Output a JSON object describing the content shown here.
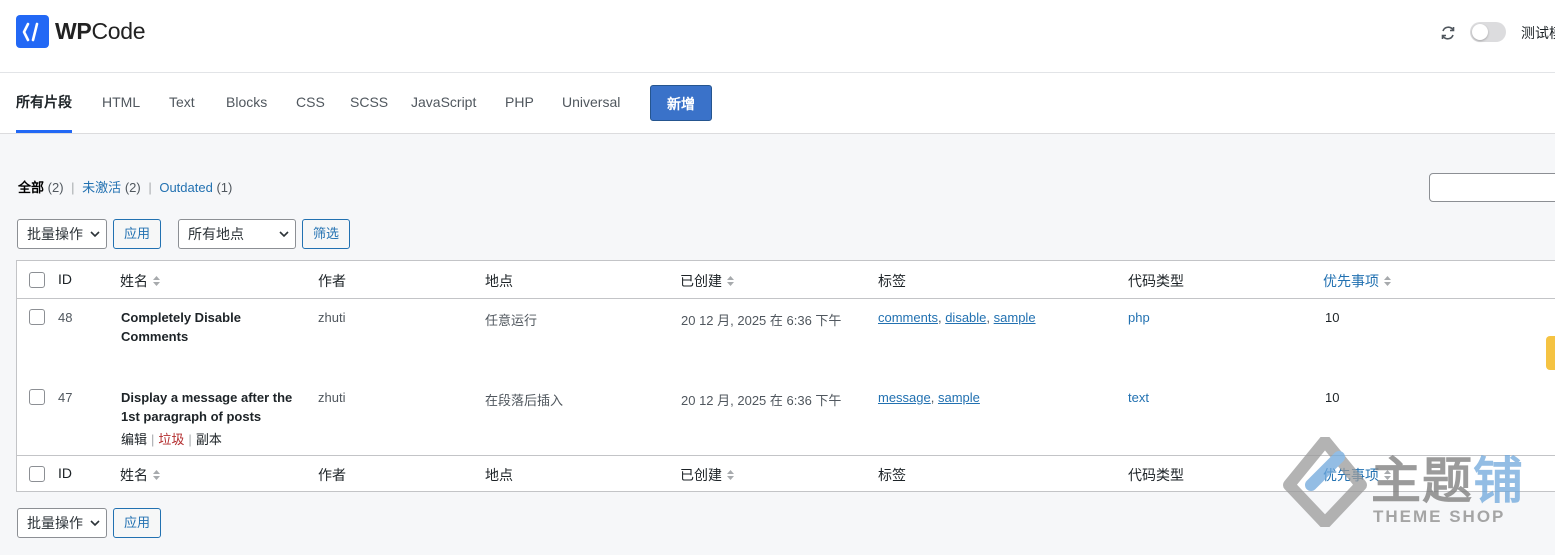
{
  "header": {
    "logo_wp": "WP",
    "logo_code": "Code",
    "test_mode_label": "测试模式"
  },
  "tabs": [
    {
      "label": "所有片段",
      "active": true
    },
    {
      "label": "HTML"
    },
    {
      "label": "Text"
    },
    {
      "label": "Blocks"
    },
    {
      "label": "CSS"
    },
    {
      "label": "SCSS"
    },
    {
      "label": "JavaScript"
    },
    {
      "label": "PHP"
    },
    {
      "label": "Universal"
    }
  ],
  "add_new_label": "新增",
  "filters": {
    "all_label": "全部",
    "all_count": "(2)",
    "inactive_label": "未激活",
    "inactive_count": "(2)",
    "outdated_label": "Outdated",
    "outdated_count": "(1)"
  },
  "bulk_action": {
    "selected": "批量操作",
    "apply_label": "应用"
  },
  "location_filter": {
    "selected": "所有地点",
    "filter_label": "筛选"
  },
  "columns": {
    "id": "ID",
    "name": "姓名",
    "author": "作者",
    "location": "地点",
    "created": "已创建",
    "tags": "标签",
    "code_type": "代码类型",
    "priority": "优先事项"
  },
  "rows": [
    {
      "id": "48",
      "name": "Completely Disable Comments",
      "author": "zhuti",
      "location": "任意运行",
      "created": "20 12 月, 2025 在 6:36 下午",
      "tags": [
        "comments",
        "disable",
        "sample"
      ],
      "code_type": "php",
      "priority": "10"
    },
    {
      "id": "47",
      "name": "Display a message after the 1st paragraph of posts",
      "author": "zhuti",
      "location": "在段落后插入",
      "created": "20 12 月, 2025 在 6:36 下午",
      "tags": [
        "message",
        "sample"
      ],
      "code_type": "text",
      "priority": "10",
      "actions": {
        "edit": "编辑",
        "trash": "垃圾",
        "duplicate": "副本"
      }
    }
  ],
  "watermark": {
    "cn_part1": "主题",
    "cn_part2": "铺",
    "en": "THEME SHOP"
  },
  "colors": {
    "brand": "#2268f5",
    "link": "#2271b1",
    "trash": "#b32d2e",
    "primary_button": "#3a72c9"
  }
}
